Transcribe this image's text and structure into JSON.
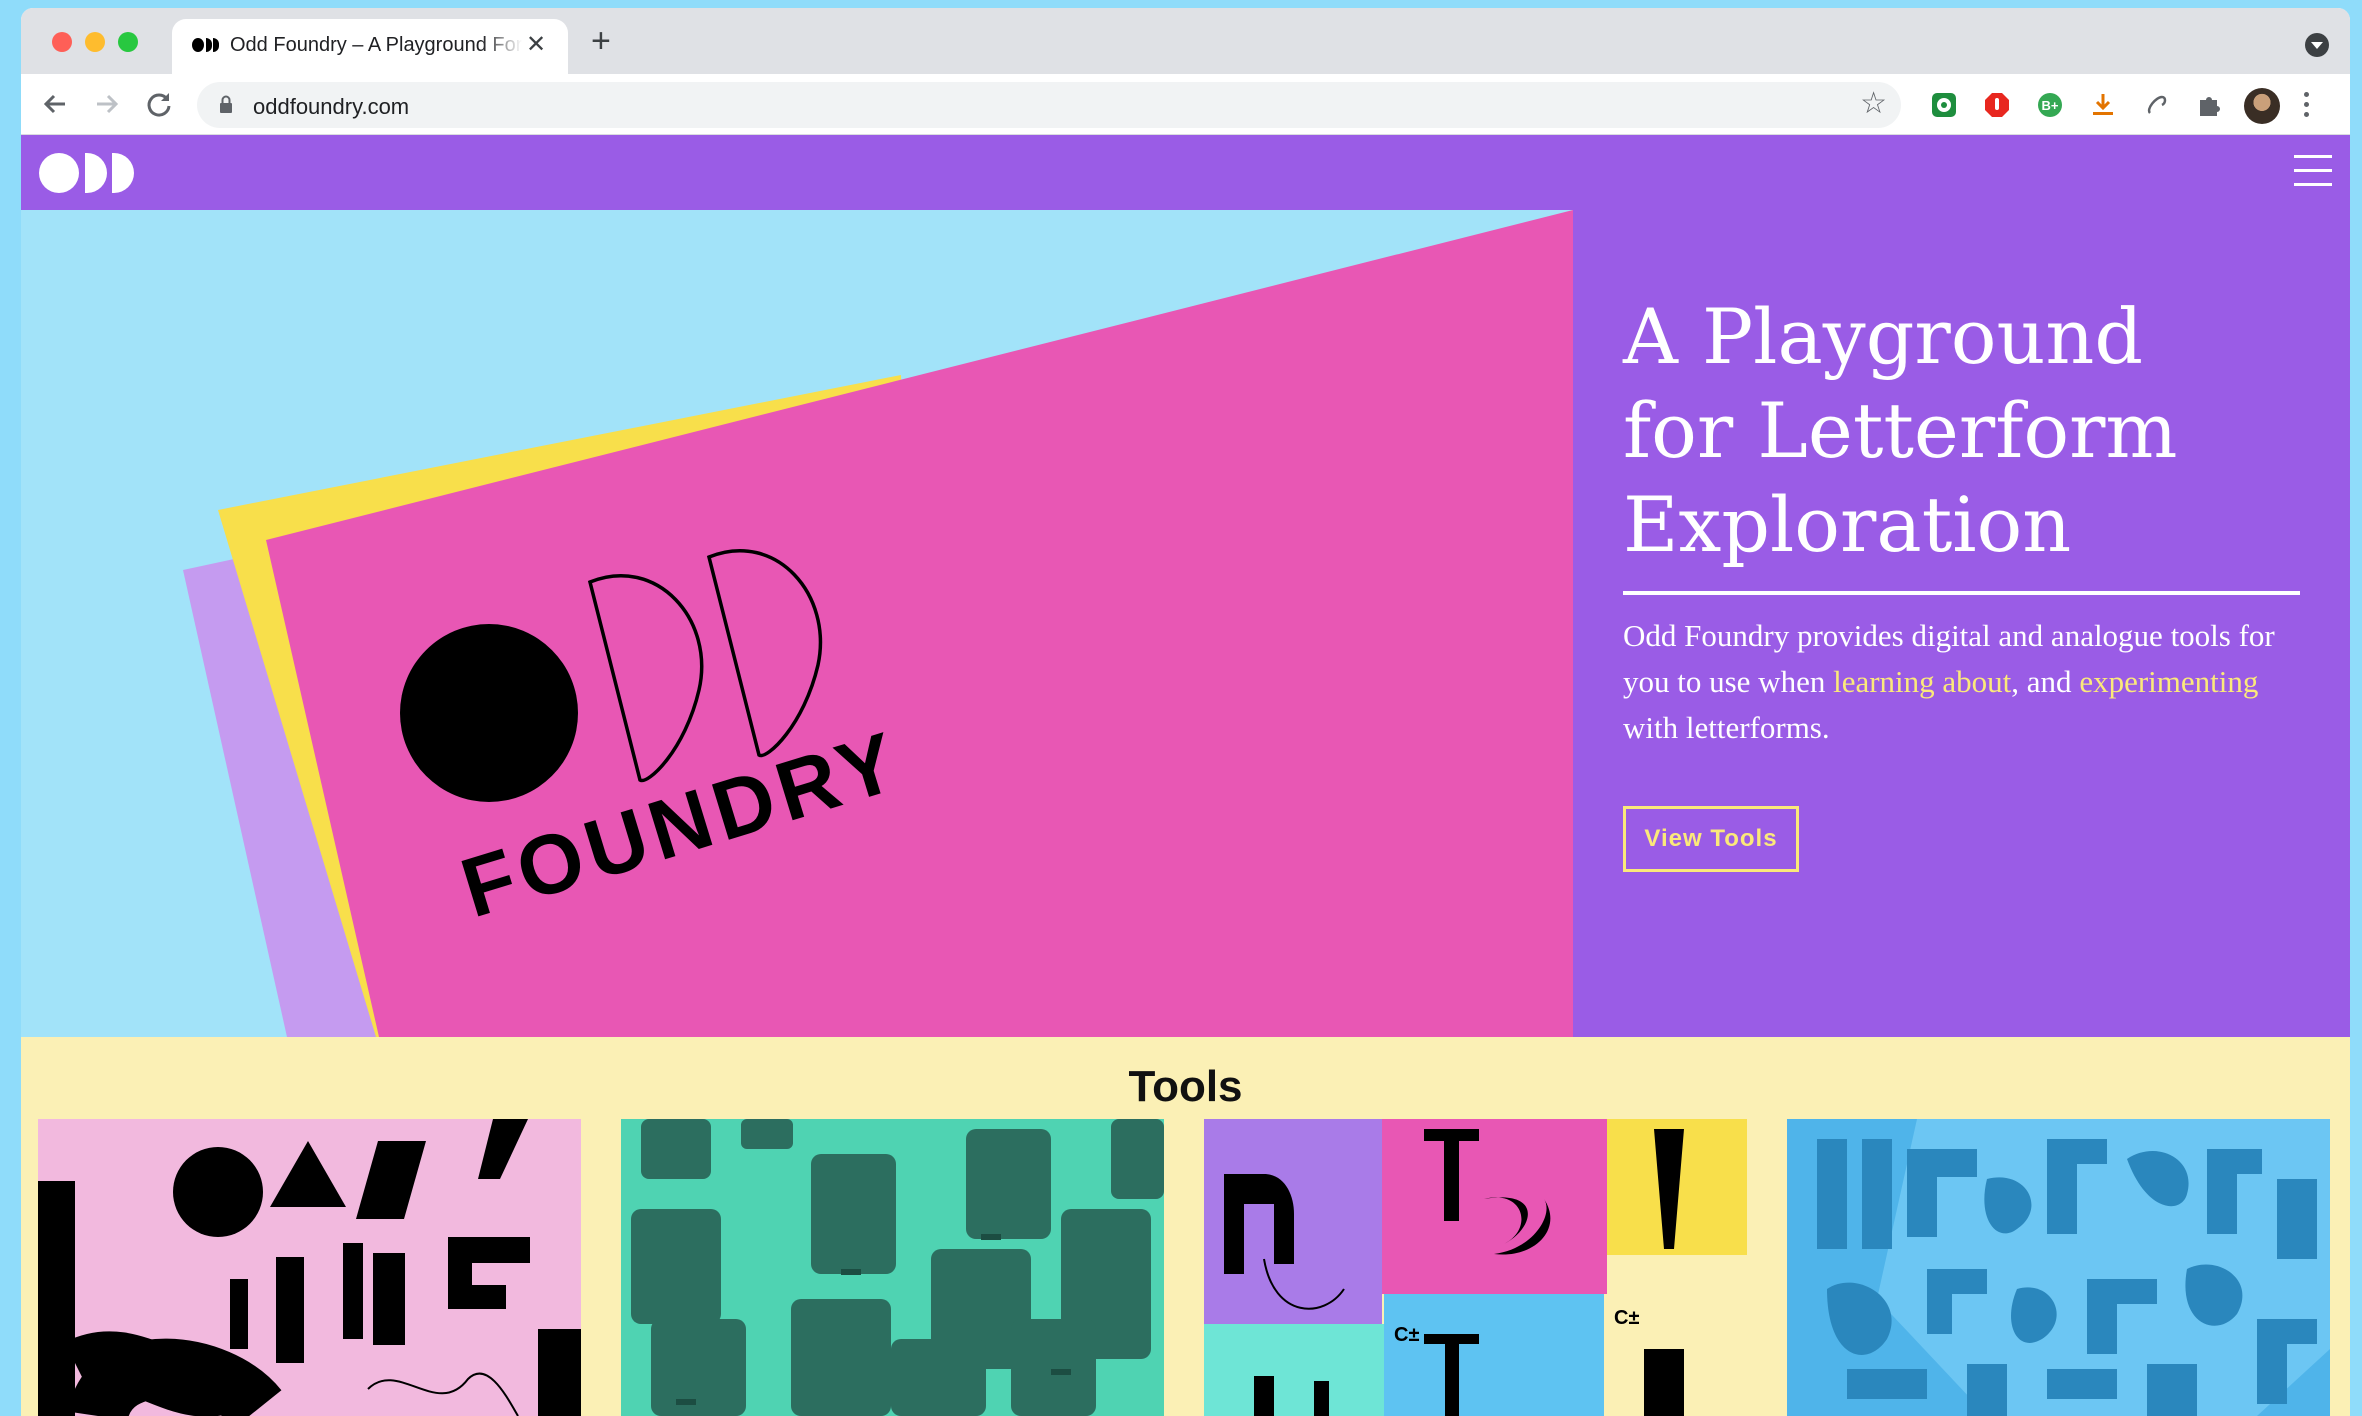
{
  "browser": {
    "tab_title": "Odd Foundry – A Playground For Letterform Exploration",
    "tab_close": "✕",
    "new_tab": "+",
    "url": "oddfoundry.com",
    "bookmark_star": "☆"
  },
  "icons": [
    "back-icon",
    "forward-icon",
    "reload-icon",
    "lock-icon",
    "star-icon",
    "extension-icon",
    "puzzle-icon",
    "menu-icon",
    "hamburger-icon"
  ],
  "colors": {
    "header_purple": "#9a5ce6",
    "hero_blue": "#a2e3f9",
    "hero_pink": "#e857b4",
    "hero_yellow": "#f8df4b",
    "accent_yellow": "#fbe97a",
    "tools_bg": "#fbf0b5"
  },
  "hero": {
    "art_wordmark_top": "ODD",
    "art_wordmark_bottom": "FOUNDRY",
    "title_line1": "A Playground",
    "title_line2": "for Letterform",
    "title_line3": "Exploration",
    "desc_part1": "Odd Foundry provides digital and analogue tools for you to use when ",
    "desc_link1": "learning about",
    "desc_part2": ", and ",
    "desc_link2": "experimenting",
    "desc_part3": " with letterforms.",
    "cta_label": "View Tools"
  },
  "tools": {
    "heading": "Tools",
    "cards": [
      {
        "name": "tool-card-1",
        "theme": "pink-black-shapes"
      },
      {
        "name": "tool-card-2",
        "theme": "green-letter-blocks"
      },
      {
        "name": "tool-card-3",
        "theme": "colorful-letter-grid"
      },
      {
        "name": "tool-card-4",
        "theme": "blue-stencil"
      }
    ]
  }
}
